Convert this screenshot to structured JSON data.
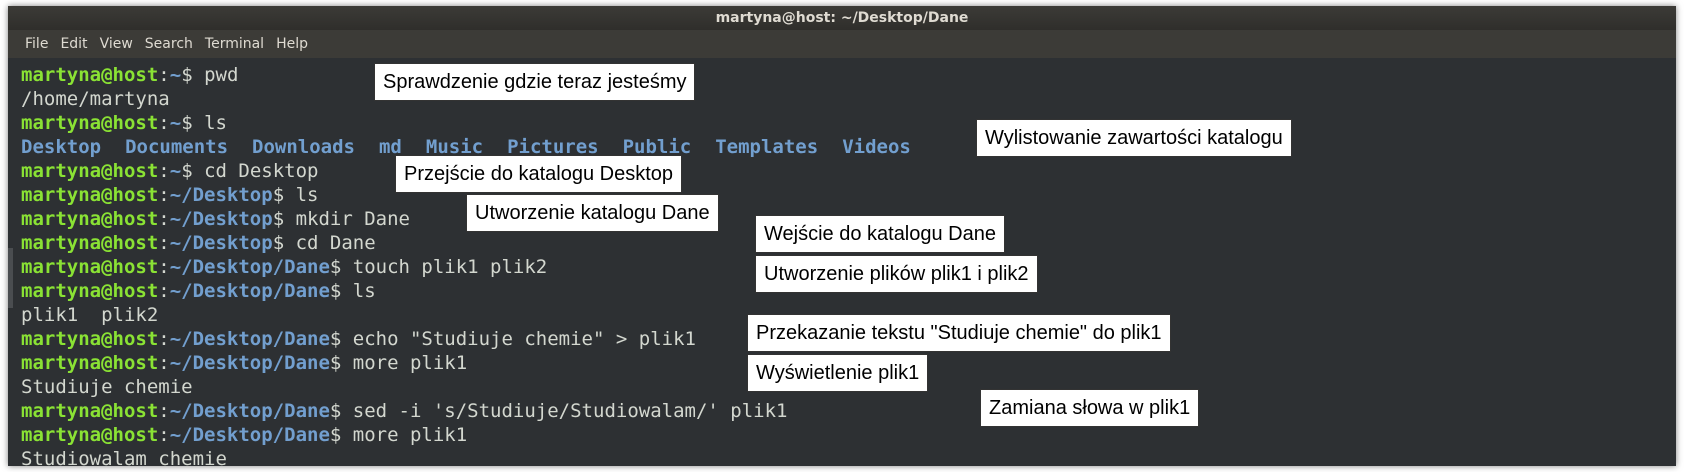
{
  "window": {
    "title": "martyna@host: ~/Desktop/Dane"
  },
  "menu": [
    "File",
    "Edit",
    "View",
    "Search",
    "Terminal",
    "Help"
  ],
  "colors": {
    "user": "#8ae234",
    "path": "#729fcf",
    "text": "#d3d7cf",
    "background": "#2d3033"
  },
  "terminal": {
    "user": "martyna@host",
    "lines": [
      {
        "type": "prompt",
        "path": "~",
        "cmd": " pwd"
      },
      {
        "type": "output",
        "text": "/home/martyna"
      },
      {
        "type": "prompt",
        "path": "~",
        "cmd": " ls"
      },
      {
        "type": "dirs",
        "items": [
          "Desktop",
          "Documents",
          "Downloads",
          "md",
          "Music",
          "Pictures",
          "Public",
          "Templates",
          "Videos"
        ]
      },
      {
        "type": "prompt",
        "path": "~",
        "cmd": " cd Desktop"
      },
      {
        "type": "prompt",
        "path": "~/Desktop",
        "cmd": " ls"
      },
      {
        "type": "prompt",
        "path": "~/Desktop",
        "cmd": " mkdir Dane"
      },
      {
        "type": "prompt",
        "path": "~/Desktop",
        "cmd": " cd Dane"
      },
      {
        "type": "prompt",
        "path": "~/Desktop/Dane",
        "cmd": " touch plik1 plik2"
      },
      {
        "type": "prompt",
        "path": "~/Desktop/Dane",
        "cmd": " ls"
      },
      {
        "type": "output",
        "text": "plik1  plik2"
      },
      {
        "type": "prompt",
        "path": "~/Desktop/Dane",
        "cmd": " echo \"Studiuje chemie\" > plik1"
      },
      {
        "type": "prompt",
        "path": "~/Desktop/Dane",
        "cmd": " more plik1"
      },
      {
        "type": "output",
        "text": "Studiuje chemie"
      },
      {
        "type": "prompt",
        "path": "~/Desktop/Dane",
        "cmd": " sed -i 's/Studiuje/Studiowalam/' plik1"
      },
      {
        "type": "prompt",
        "path": "~/Desktop/Dane",
        "cmd": " more plik1"
      },
      {
        "type": "output",
        "text": "Studiowalam chemie"
      }
    ]
  },
  "annotations": [
    "Sprawdzenie gdzie teraz jesteśmy",
    "Wylistowanie zawartości katalogu",
    "Przejście do katalogu Desktop",
    "Utworzenie katalogu Dane",
    "Wejście do katalogu Dane",
    "Utworzenie plików plik1 i plik2",
    "Przekazanie tekstu \"Studiuje chemie\" do plik1",
    "Wyświetlenie plik1",
    "Zamiana słowa w plik1"
  ]
}
